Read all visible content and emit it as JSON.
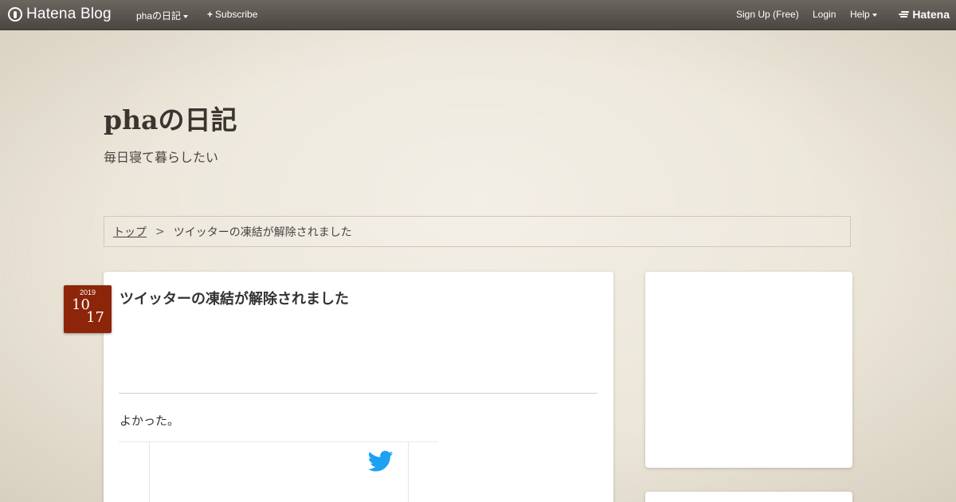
{
  "topbar": {
    "logo_text": "Hatena Blog",
    "blog_menu_label": "phaの日記",
    "subscribe_label": "Subscribe",
    "signup_label": "Sign Up (Free)",
    "login_label": "Login",
    "help_label": "Help",
    "brand_label": "Hatena"
  },
  "header": {
    "title": "phaの日記",
    "description": "毎日寝て暮らしたい"
  },
  "breadcrumb": {
    "home_label": "トップ",
    "separator": ">",
    "current_label": "ツイッターの凍結が解除されました"
  },
  "entry": {
    "date": {
      "year": "2019",
      "month": "10",
      "day": "17"
    },
    "title": "ツイッターの凍結が解除されました",
    "body_text": "よかった。",
    "embed_icon": "twitter-bird-icon"
  },
  "colors": {
    "date_badge": "#8c2509",
    "twitter_blue": "#1da1f2",
    "topbar": "#55514c",
    "page_bg": "#ece6d9"
  }
}
